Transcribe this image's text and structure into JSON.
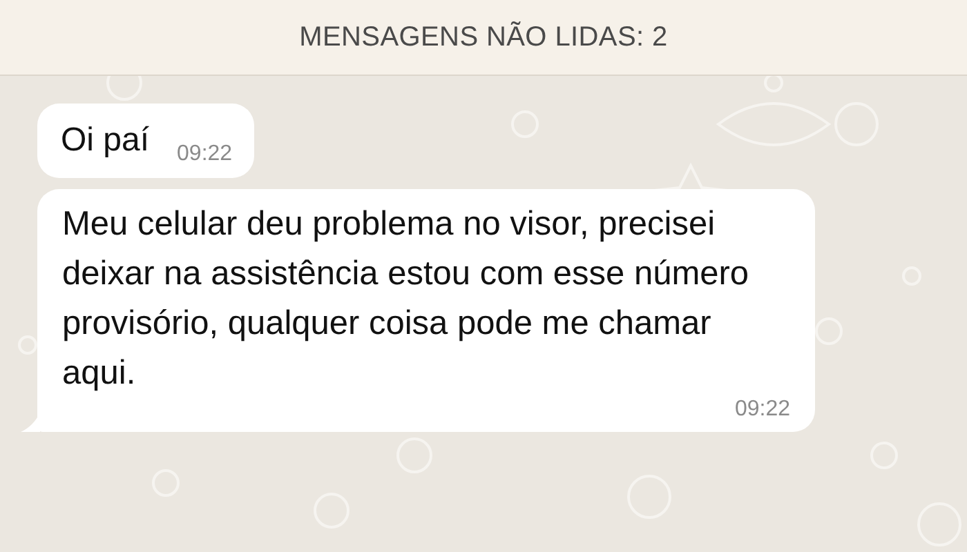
{
  "banner": {
    "text": "MENSAGENS NÃO LIDAS: 2"
  },
  "messages": [
    {
      "text": "Oi paí",
      "time": "09:22",
      "tail": false
    },
    {
      "text": "Meu celular deu problema no visor, precisei deixar na assistência estou com esse número provisório, qualquer coisa pode me chamar aqui.",
      "time": "09:22",
      "tail": true
    }
  ]
}
